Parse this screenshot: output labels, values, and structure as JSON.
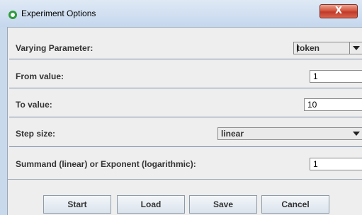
{
  "window": {
    "title": "Experiment Options",
    "close_label": "X"
  },
  "fields": {
    "varying_parameter": {
      "label": "Varying Parameter:",
      "value": "token"
    },
    "from_value": {
      "label": "From value:",
      "value": "1"
    },
    "to_value": {
      "label": "To value:",
      "value": "10"
    },
    "step_size": {
      "label": "Step size:",
      "value": "linear"
    },
    "summand": {
      "label": "Summand (linear) or Exponent (logarithmic):",
      "value": "1"
    }
  },
  "buttons": {
    "start": "Start",
    "load": "Load",
    "save": "Save",
    "cancel": "Cancel"
  }
}
